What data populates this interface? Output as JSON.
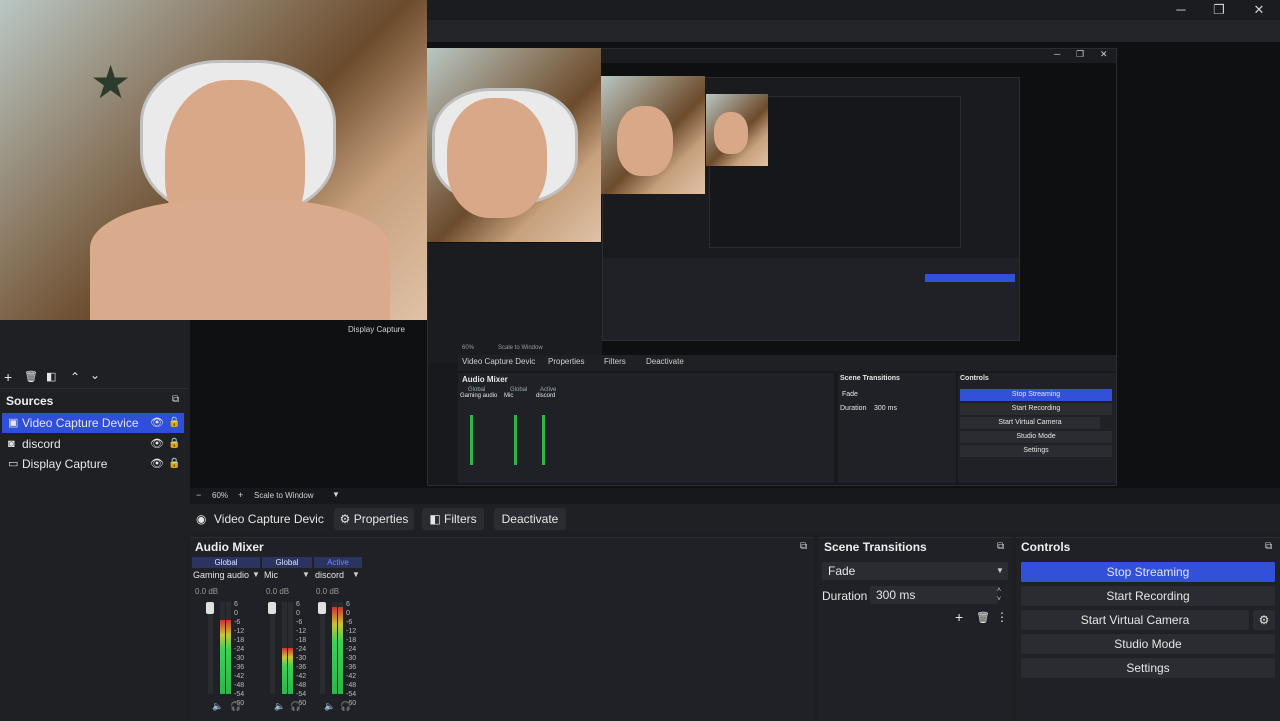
{
  "window": {
    "minimize": "─",
    "maximize": "❐",
    "close": "✕"
  },
  "sources": {
    "title": "Sources",
    "items": [
      {
        "label": "Video Capture Device",
        "selected": true,
        "icon": "camera-icon"
      },
      {
        "label": "discord",
        "selected": false,
        "icon": "audio-icon"
      },
      {
        "label": "Display Capture",
        "selected": false,
        "icon": "monitor-icon"
      }
    ],
    "toolbar": {
      "add": "+",
      "remove": "🗑",
      "filters": "◧",
      "up": "⌃",
      "down": "⌄"
    }
  },
  "preview_nested": {
    "display_capture_label": "Display Capture",
    "zoom": "60%",
    "scale": "Scale to Window",
    "source_toolbar": {
      "source": "Video Capture Devic",
      "properties": "Properties",
      "filters": "Filters",
      "deactivate": "Deactivate"
    },
    "audio_mixer": "Audio Mixer",
    "scene_transitions": "Scene Transitions",
    "controls": "Controls",
    "fade": "Fade",
    "duration_label": "Duration",
    "duration": "300 ms",
    "stop_streaming": "Stop Streaming",
    "start_recording": "Start Recording",
    "start_virtual_camera": "Start Virtual Camera",
    "studio_mode": "Studio Mode",
    "settings": "Settings",
    "channels": [
      {
        "tag": "Global",
        "name": "Gaming audio"
      },
      {
        "tag": "Global",
        "name": "Mic"
      },
      {
        "tag": "Active",
        "name": "discord"
      }
    ]
  },
  "zoombar": {
    "minus": "−",
    "zoom": "60%",
    "plus": "+",
    "scale": "Scale to Window"
  },
  "source_toolbar": {
    "source_label": "Video Capture Devic",
    "properties": "Properties",
    "filters": "Filters",
    "deactivate": "Deactivate"
  },
  "audio_mixer": {
    "title": "Audio Mixer",
    "channels": [
      {
        "tag": "Global",
        "name": "Gaming audio",
        "db": "0.0 dB",
        "level": 0.8
      },
      {
        "tag": "Global",
        "name": "Mic",
        "db": "0.0 dB",
        "level": 0.5
      },
      {
        "tag": "Active",
        "name": "discord",
        "db": "0.0 dB",
        "level": 0.95
      }
    ],
    "scale": [
      "6",
      "0",
      "-6",
      "-12",
      "-18",
      "-24",
      "-30",
      "-36",
      "-42",
      "-48",
      "-54",
      "-60"
    ]
  },
  "scene_transitions": {
    "title": "Scene Transitions",
    "transition": "Fade",
    "duration_label": "Duration",
    "duration": "300 ms",
    "add": "+",
    "remove": "🗑",
    "more": "⋮"
  },
  "controls": {
    "title": "Controls",
    "stop_streaming": "Stop Streaming",
    "start_recording": "Start Recording",
    "start_virtual_camera": "Start Virtual Camera",
    "studio_mode": "Studio Mode",
    "settings": "Settings"
  },
  "colors": {
    "accent": "#3350d8",
    "background": "#1e1f22",
    "panel": "#202126"
  }
}
